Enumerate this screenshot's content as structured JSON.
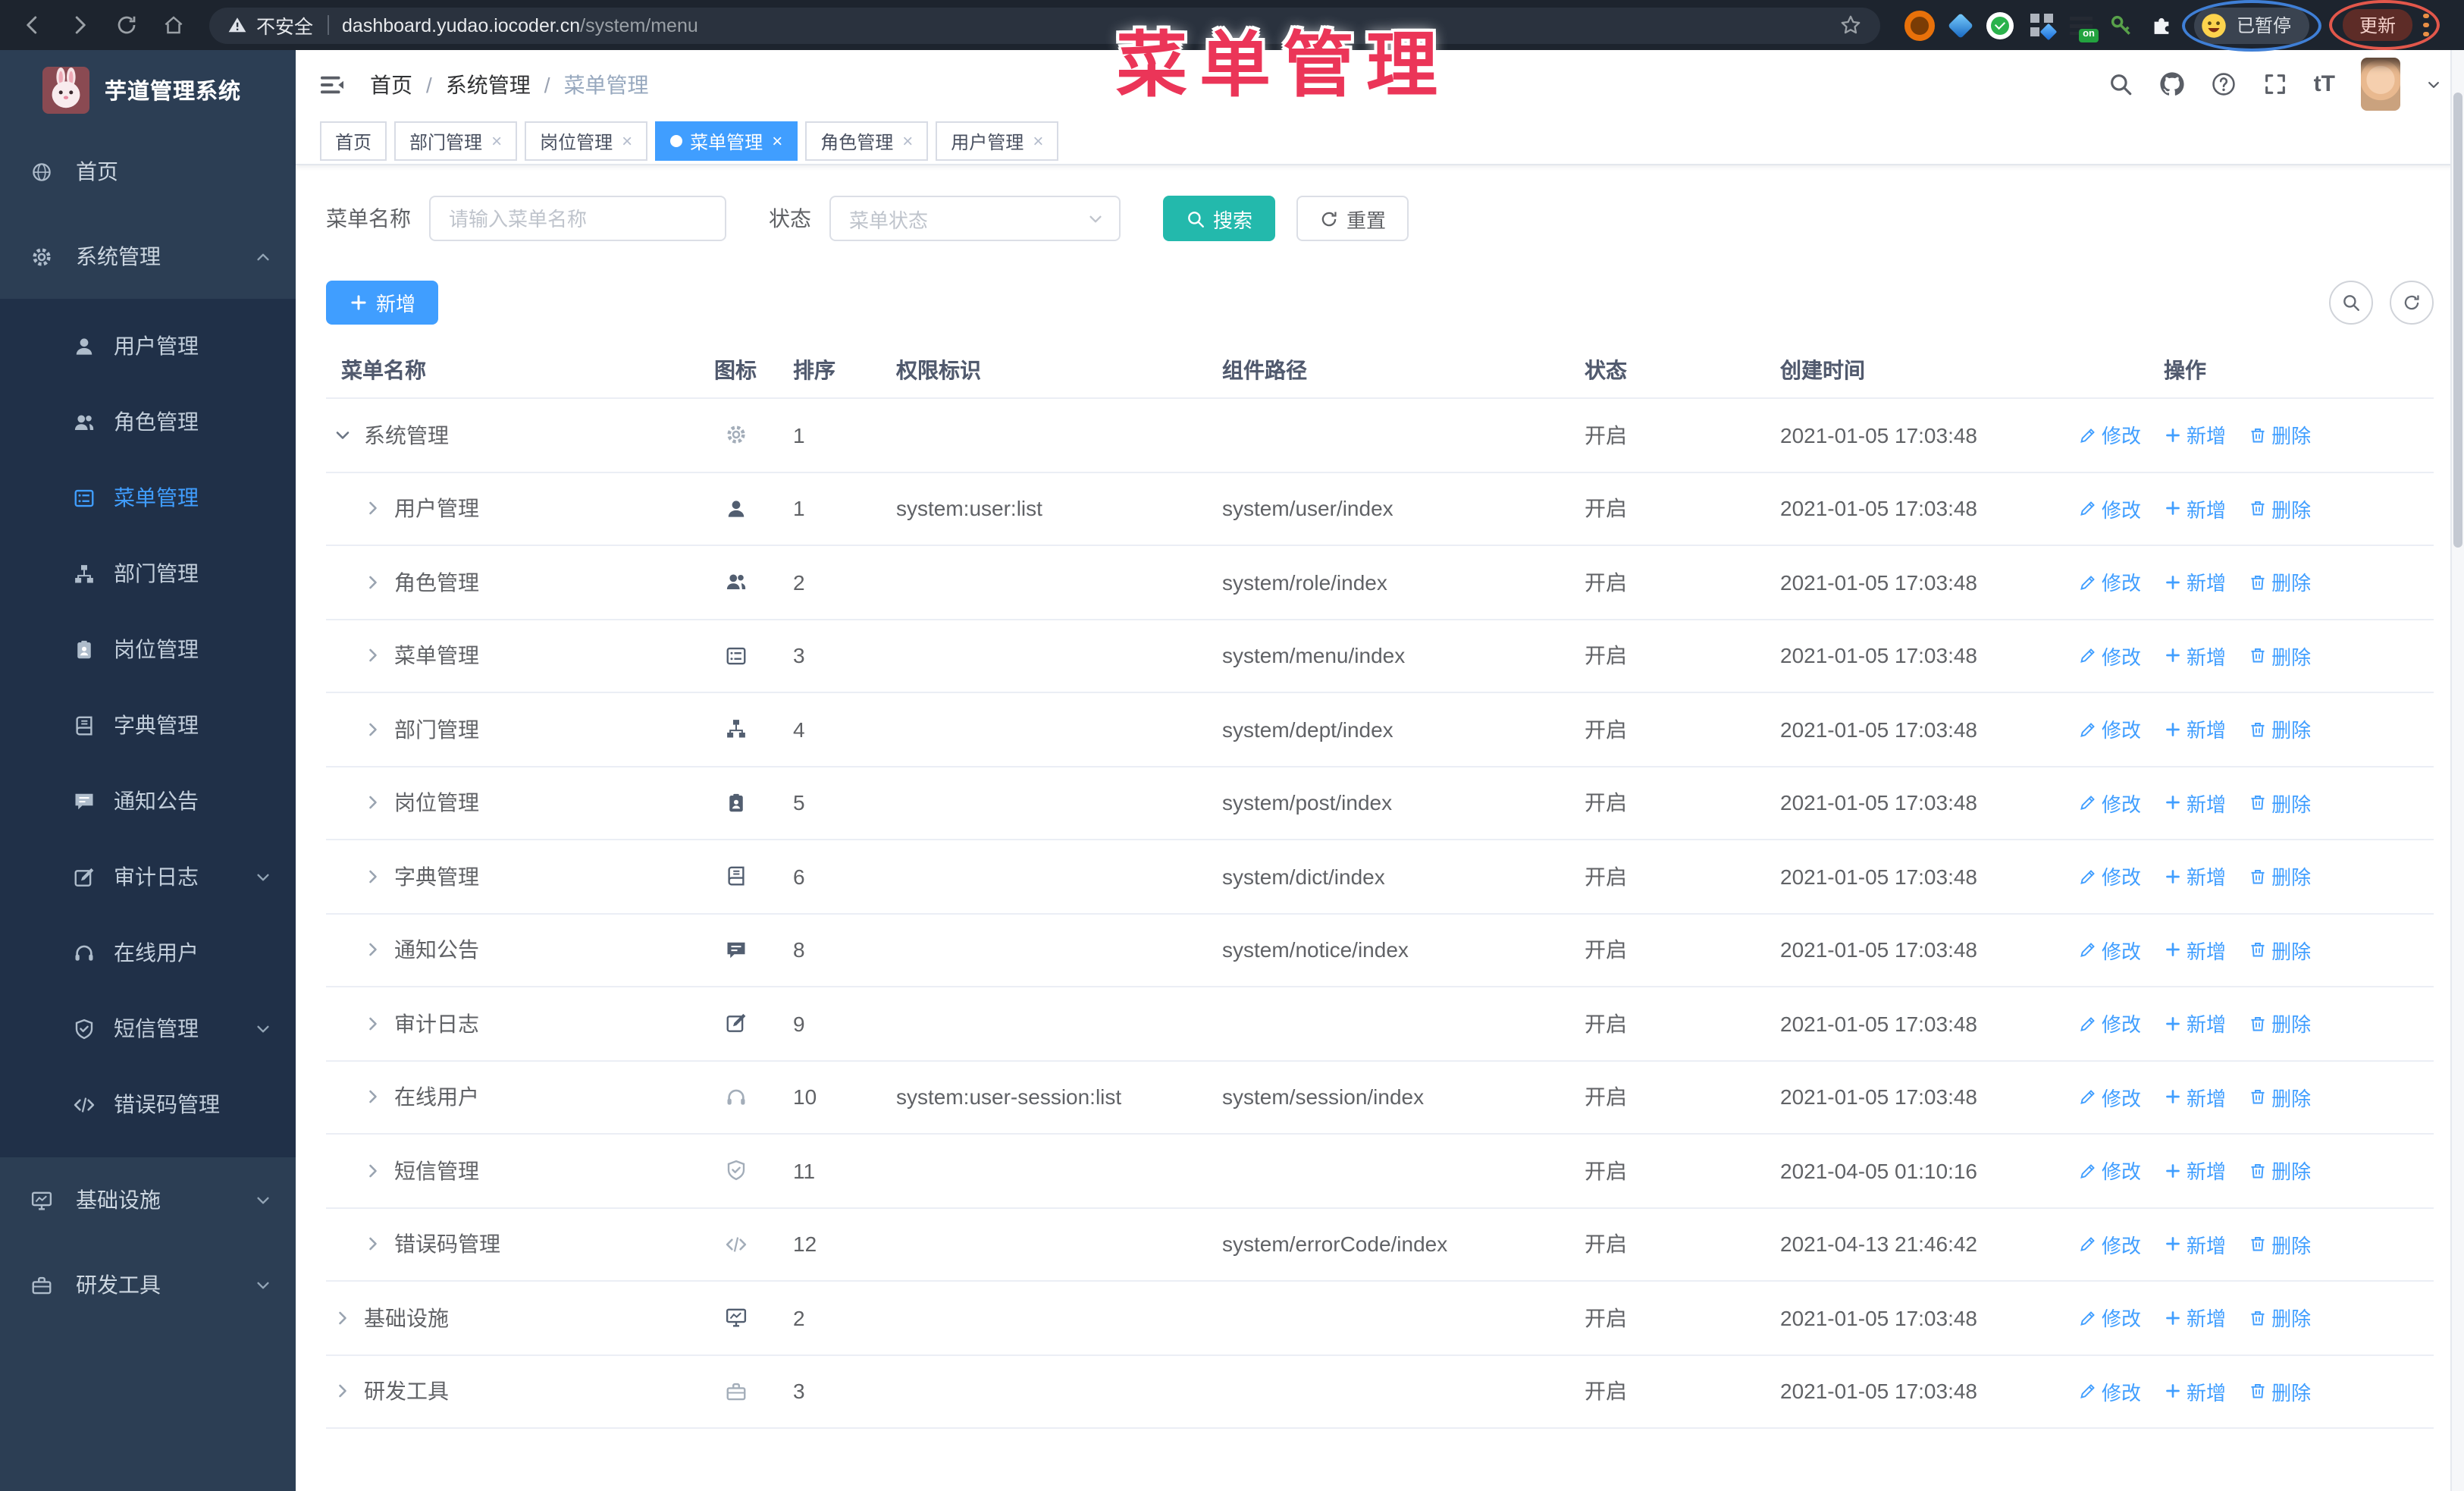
{
  "browser": {
    "security_label": "不安全",
    "url_host": "dashboard.yudao.iocoder.cn",
    "url_path": "/system/menu",
    "extension_badge": "on",
    "profile_label": "已暂停",
    "update_label": "更新"
  },
  "overlay": {
    "title": "菜单管理",
    "color": "#eb3558"
  },
  "sidebar": {
    "logo_title": "芋道管理系统",
    "menu": [
      {
        "key": "home",
        "label": "首页",
        "icon": "globe"
      },
      {
        "key": "system",
        "label": "系统管理",
        "icon": "gear",
        "chevron": "up",
        "expanded": true,
        "children": [
          {
            "key": "user",
            "label": "用户管理",
            "icon": "user"
          },
          {
            "key": "role",
            "label": "角色管理",
            "icon": "users"
          },
          {
            "key": "menu",
            "label": "菜单管理",
            "icon": "list",
            "active": true
          },
          {
            "key": "dept",
            "label": "部门管理",
            "icon": "tree"
          },
          {
            "key": "post",
            "label": "岗位管理",
            "icon": "badge"
          },
          {
            "key": "dict",
            "label": "字典管理",
            "icon": "book"
          },
          {
            "key": "notice",
            "label": "通知公告",
            "icon": "chat"
          },
          {
            "key": "audit-log",
            "label": "审计日志",
            "icon": "edit",
            "chevron": "down"
          },
          {
            "key": "online-user",
            "label": "在线用户",
            "icon": "headset"
          },
          {
            "key": "sms",
            "label": "短信管理",
            "icon": "shield",
            "chevron": "down"
          },
          {
            "key": "error-code",
            "label": "错误码管理",
            "icon": "code"
          }
        ]
      },
      {
        "key": "infra",
        "label": "基础设施",
        "icon": "monitor",
        "chevron": "down"
      },
      {
        "key": "dev-tool",
        "label": "研发工具",
        "icon": "toolbox",
        "chevron": "down"
      }
    ]
  },
  "header": {
    "breadcrumbs": [
      "首页",
      "系统管理",
      "菜单管理"
    ],
    "breadcrumb_separator": "/",
    "fontsize_label": "tT"
  },
  "tags": {
    "close_glyph": "×",
    "items": [
      {
        "key": "home",
        "label": "首页",
        "closable": false,
        "active": false
      },
      {
        "key": "dept",
        "label": "部门管理",
        "closable": true,
        "active": false
      },
      {
        "key": "post",
        "label": "岗位管理",
        "closable": true,
        "active": false
      },
      {
        "key": "menu",
        "label": "菜单管理",
        "closable": true,
        "active": true
      },
      {
        "key": "role",
        "label": "角色管理",
        "closable": true,
        "active": false
      },
      {
        "key": "user",
        "label": "用户管理",
        "closable": true,
        "active": false
      }
    ]
  },
  "filters": {
    "name_label": "菜单名称",
    "name_placeholder": "请输入菜单名称",
    "status_label": "状态",
    "status_placeholder": "菜单状态",
    "search_label": "搜索",
    "reset_label": "重置"
  },
  "toolbar": {
    "add_label": "新增"
  },
  "colors": {
    "primary": "#409eff",
    "search_button": "#23b9ac",
    "sidebar_bg": "#2c3e54",
    "submenu_bg": "#203048",
    "annotation_red": "#eb3558",
    "status_active_tag": "#409eff"
  },
  "icons": {
    "search": "magnifier-shape",
    "refresh": "circular-arrow",
    "gear": "cog",
    "globe": "sphere",
    "user": "person",
    "users": "people",
    "list": "menu-list",
    "tree": "org-tree",
    "badge": "id-card",
    "book": "dictionary",
    "chat": "speech-bubble",
    "edit": "pen-square",
    "headset": "headphones",
    "shield": "shield-check",
    "code": "angle-brackets",
    "monitor": "screen-chart",
    "toolbox": "tool-case",
    "pencil": "edit-pen",
    "plus": "+",
    "trash": "waste-bin",
    "caret": "chevron",
    "star": "bookmark-star",
    "warning": "alert-triangle",
    "github": "octocat",
    "question": "help-circle",
    "fullscreen": "expand-corners"
  },
  "table": {
    "columns": [
      "菜单名称",
      "图标",
      "排序",
      "权限标识",
      "组件路径",
      "状态",
      "创建时间",
      "操作"
    ],
    "action_labels": {
      "edit": "修改",
      "add": "新增",
      "delete": "删除"
    },
    "rows": [
      {
        "name": "系统管理",
        "icon": "gear",
        "level": 0,
        "expanded": true,
        "sort": "1",
        "perm": "",
        "path": "",
        "status": "开启",
        "created": "2021-01-05 17:03:48"
      },
      {
        "name": "用户管理",
        "icon": "user",
        "level": 1,
        "expanded": false,
        "sort": "1",
        "perm": "system:user:list",
        "path": "system/user/index",
        "status": "开启",
        "created": "2021-01-05 17:03:48"
      },
      {
        "name": "角色管理",
        "icon": "users",
        "level": 1,
        "expanded": false,
        "sort": "2",
        "perm": "",
        "path": "system/role/index",
        "status": "开启",
        "created": "2021-01-05 17:03:48"
      },
      {
        "name": "菜单管理",
        "icon": "list",
        "level": 1,
        "expanded": false,
        "sort": "3",
        "perm": "",
        "path": "system/menu/index",
        "status": "开启",
        "created": "2021-01-05 17:03:48"
      },
      {
        "name": "部门管理",
        "icon": "tree",
        "level": 1,
        "expanded": false,
        "sort": "4",
        "perm": "",
        "path": "system/dept/index",
        "status": "开启",
        "created": "2021-01-05 17:03:48"
      },
      {
        "name": "岗位管理",
        "icon": "badge",
        "level": 1,
        "expanded": false,
        "sort": "5",
        "perm": "",
        "path": "system/post/index",
        "status": "开启",
        "created": "2021-01-05 17:03:48"
      },
      {
        "name": "字典管理",
        "icon": "book",
        "level": 1,
        "expanded": false,
        "sort": "6",
        "perm": "",
        "path": "system/dict/index",
        "status": "开启",
        "created": "2021-01-05 17:03:48"
      },
      {
        "name": "通知公告",
        "icon": "chat",
        "level": 1,
        "expanded": false,
        "sort": "8",
        "perm": "",
        "path": "system/notice/index",
        "status": "开启",
        "created": "2021-01-05 17:03:48"
      },
      {
        "name": "审计日志",
        "icon": "edit",
        "level": 1,
        "expanded": false,
        "sort": "9",
        "perm": "",
        "path": "",
        "status": "开启",
        "created": "2021-01-05 17:03:48"
      },
      {
        "name": "在线用户",
        "icon": "headset",
        "level": 1,
        "expanded": false,
        "sort": "10",
        "perm": "system:user-session:list",
        "path": "system/session/index",
        "status": "开启",
        "created": "2021-01-05 17:03:48"
      },
      {
        "name": "短信管理",
        "icon": "shield",
        "level": 1,
        "expanded": false,
        "sort": "11",
        "perm": "",
        "path": "",
        "status": "开启",
        "created": "2021-04-05 01:10:16"
      },
      {
        "name": "错误码管理",
        "icon": "code",
        "level": 1,
        "expanded": false,
        "sort": "12",
        "perm": "",
        "path": "system/errorCode/index",
        "status": "开启",
        "created": "2021-04-13 21:46:42"
      },
      {
        "name": "基础设施",
        "icon": "monitor",
        "level": 0,
        "expanded": false,
        "sort": "2",
        "perm": "",
        "path": "",
        "status": "开启",
        "created": "2021-01-05 17:03:48"
      },
      {
        "name": "研发工具",
        "icon": "toolbox",
        "level": 0,
        "expanded": false,
        "sort": "3",
        "perm": "",
        "path": "",
        "status": "开启",
        "created": "2021-01-05 17:03:48"
      }
    ]
  }
}
